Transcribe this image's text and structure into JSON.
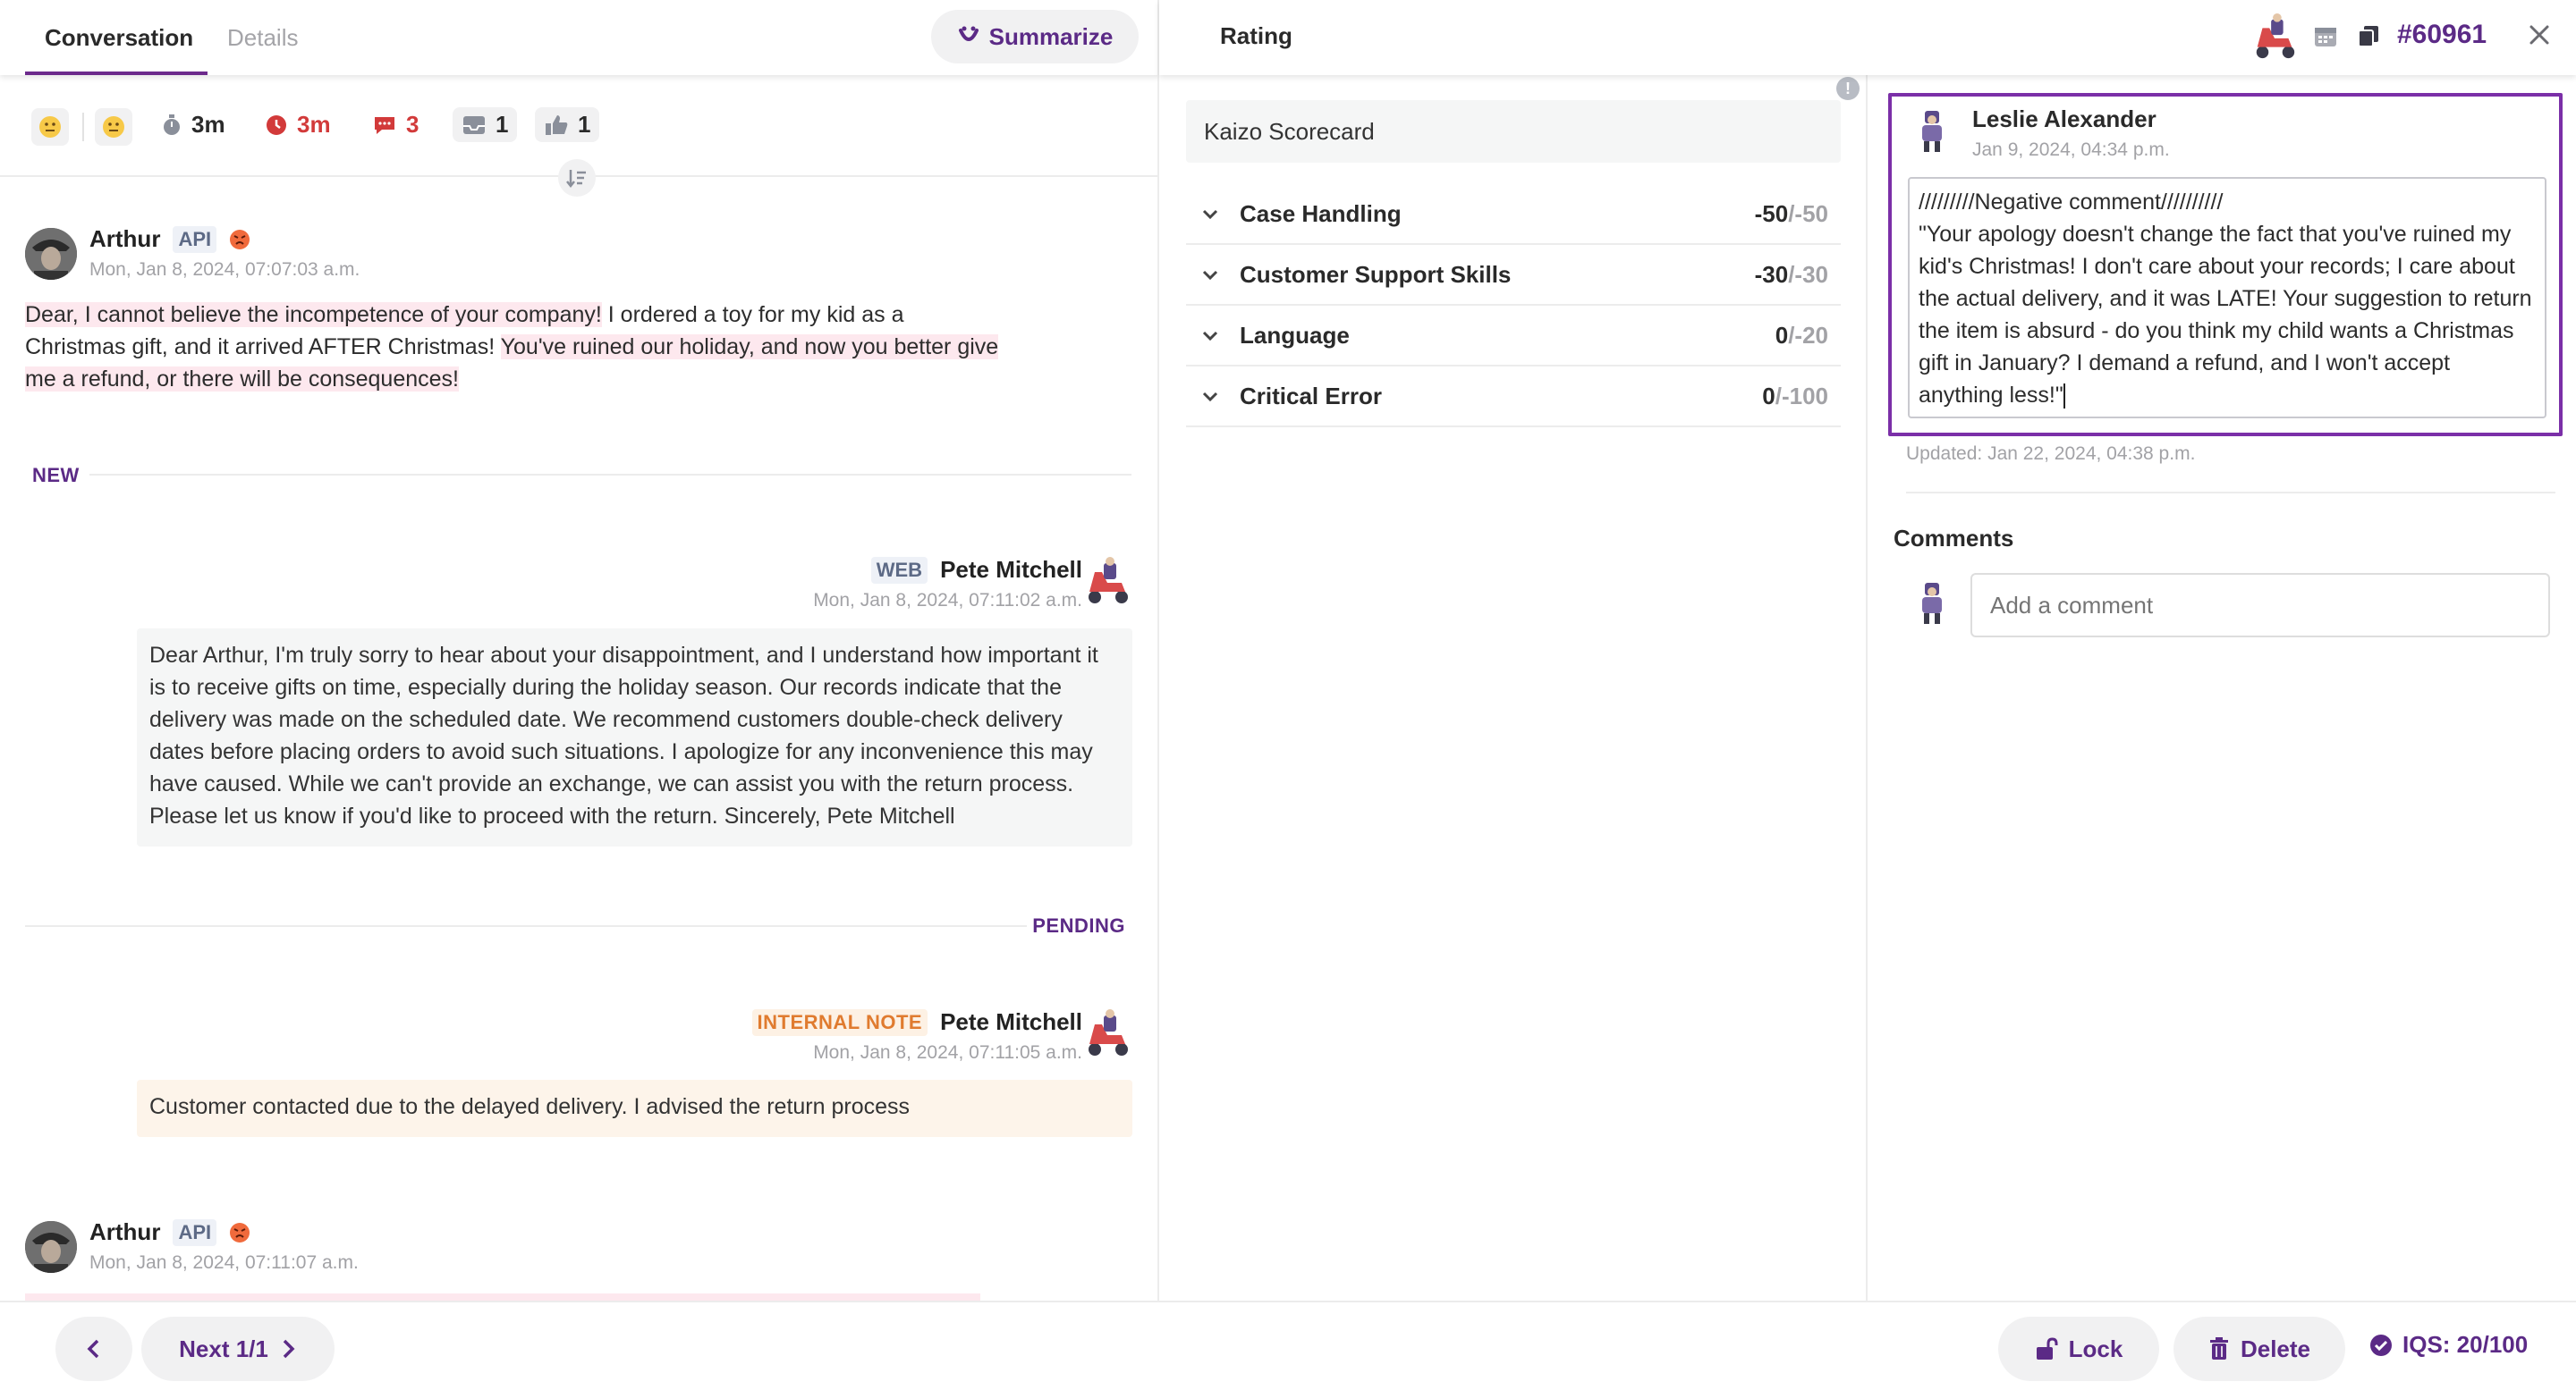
{
  "tabs": {
    "conversation": "Conversation",
    "details": "Details"
  },
  "summarize_label": "Summarize",
  "stats": {
    "handle_time": "3m",
    "response_time": "3m",
    "messages": "3",
    "tickets": "1",
    "likes": "1"
  },
  "messages": [
    {
      "author": "Arthur",
      "channel": "API",
      "timestamp": "Mon, Jan 8, 2024, 07:07:03 a.m.",
      "parts": [
        {
          "text": "Dear, I cannot believe the incompetence of your company!",
          "hl": true
        },
        {
          "text": " I ordered a toy for my kid as a",
          "hl": false
        },
        {
          "text": "Christmas gift, and it arrived AFTER Christmas! ",
          "hl": false
        },
        {
          "text": "You've ruined our holiday, and now you better give",
          "hl": true
        },
        {
          "text": "me a refund, or there will be consequences!",
          "hl": true
        }
      ]
    },
    {
      "author": "Pete Mitchell",
      "channel": "WEB",
      "timestamp": "Mon, Jan 8, 2024, 07:11:02 a.m.",
      "body": "Dear Arthur, I'm truly sorry to hear about your disappointment, and I understand how important it is to receive gifts on time, especially during the holiday season. Our records indicate that the delivery was made on the scheduled date. We recommend customers double-check delivery dates before placing orders to avoid such situations. I apologize for any inconvenience this may have caused. While we can't provide an exchange, we can assist you with the return process. Please let us know if you'd like to proceed with the return. Sincerely, Pete Mitchell"
    },
    {
      "author": "Pete Mitchell",
      "channel": "INTERNAL NOTE",
      "timestamp": "Mon, Jan 8, 2024, 07:11:05 a.m.",
      "body": "Customer contacted due to the delayed delivery. I advised the return process"
    },
    {
      "author": "Arthur",
      "channel": "API",
      "timestamp": "Mon, Jan 8, 2024, 07:11:07 a.m."
    }
  ],
  "dividers": {
    "new": "NEW",
    "pending": "PENDING"
  },
  "rating": {
    "title": "Rating",
    "ticket_id": "#60961",
    "scorecard": "Kaizo Scorecard",
    "categories": [
      {
        "name": "Case Handling",
        "score": "-50",
        "max": "/-50"
      },
      {
        "name": "Customer Support Skills",
        "score": "-30",
        "max": "/-30"
      },
      {
        "name": "Language",
        "score": "0",
        "max": "/-20"
      },
      {
        "name": "Critical Error",
        "score": "0",
        "max": "/-100"
      }
    ]
  },
  "review": {
    "reviewer": "Leslie Alexander",
    "date": "Jan 9, 2024, 04:34 p.m.",
    "line1": "/////////Negative comment//////////",
    "body": "\"Your apology doesn't change the fact that you've ruined my kid's Christmas! I don't care about your records; I care about the actual delivery, and it was LATE! Your suggestion to return the item is absurd - do you think my child wants a Christmas gift in January? I demand a refund, and I won't accept anything less!\"",
    "updated": "Updated: Jan 22, 2024, 04:38 p.m."
  },
  "comments": {
    "title": "Comments",
    "placeholder": "Add a comment"
  },
  "footer": {
    "next_label": "Next 1/1",
    "lock_label": "Lock",
    "delete_label": "Delete",
    "iqs_label": "IQS: 20/100"
  },
  "colors": {
    "accent": "#5b2a86",
    "highlight": "#fde8ee",
    "note_bg": "#fdf4ea",
    "alert_red": "#d23a3a"
  }
}
